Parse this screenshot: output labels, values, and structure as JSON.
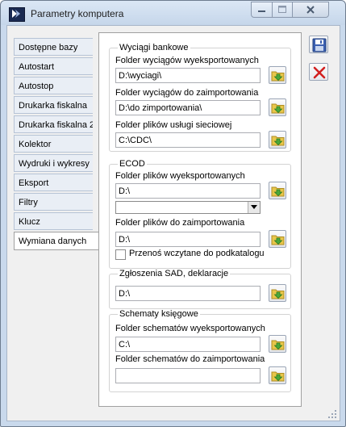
{
  "window": {
    "title": "Parametry komputera",
    "icon": "app-logo-icon"
  },
  "tabs": [
    {
      "label": "Dostępne bazy",
      "active": false
    },
    {
      "label": "Autostart",
      "active": false
    },
    {
      "label": "Autostop",
      "active": false
    },
    {
      "label": "Drukarka fiskalna",
      "active": false
    },
    {
      "label": "Drukarka fiskalna 2",
      "active": false
    },
    {
      "label": "Kolektor",
      "active": false
    },
    {
      "label": "Wydruki i wykresy",
      "active": false
    },
    {
      "label": "Eksport",
      "active": false
    },
    {
      "label": "Filtry",
      "active": false
    },
    {
      "label": "Klucz",
      "active": false
    },
    {
      "label": "Wymiana danych",
      "active": true
    }
  ],
  "bank": {
    "title": "Wyciągi bankowe",
    "export_label": "Folder wyciągów wyeksportowanych",
    "export_value": "D:\\wyciagi\\",
    "import_label": "Folder wyciągów do zaimportowania",
    "import_value": "D:\\do zimportowania\\",
    "service_label": "Folder plików usługi sieciowej",
    "service_value": "C:\\CDC\\"
  },
  "ecod": {
    "title": "ECOD",
    "export_label": "Folder plików wyeksportowanych",
    "export_value": "D:\\",
    "combo_value": "",
    "import_label": "Folder plików do zaimportowania",
    "import_value": "D:\\",
    "move_checkbox_label": "Przenoś wczytane do podkatalogu",
    "move_checked": false
  },
  "sad": {
    "title": "Zgłoszenia SAD, deklaracje",
    "value": "D:\\"
  },
  "schemes": {
    "title": "Schematy księgowe",
    "export_label": "Folder schematów wyeksportowanych",
    "export_value": "C:\\",
    "import_label": "Folder schematów do zaimportowania",
    "import_value": ""
  },
  "colors": {
    "folder_icon": "#e8c64a",
    "arrow": "#4aa83a",
    "save": "#3b5fb0",
    "delete": "#d21f1f"
  }
}
